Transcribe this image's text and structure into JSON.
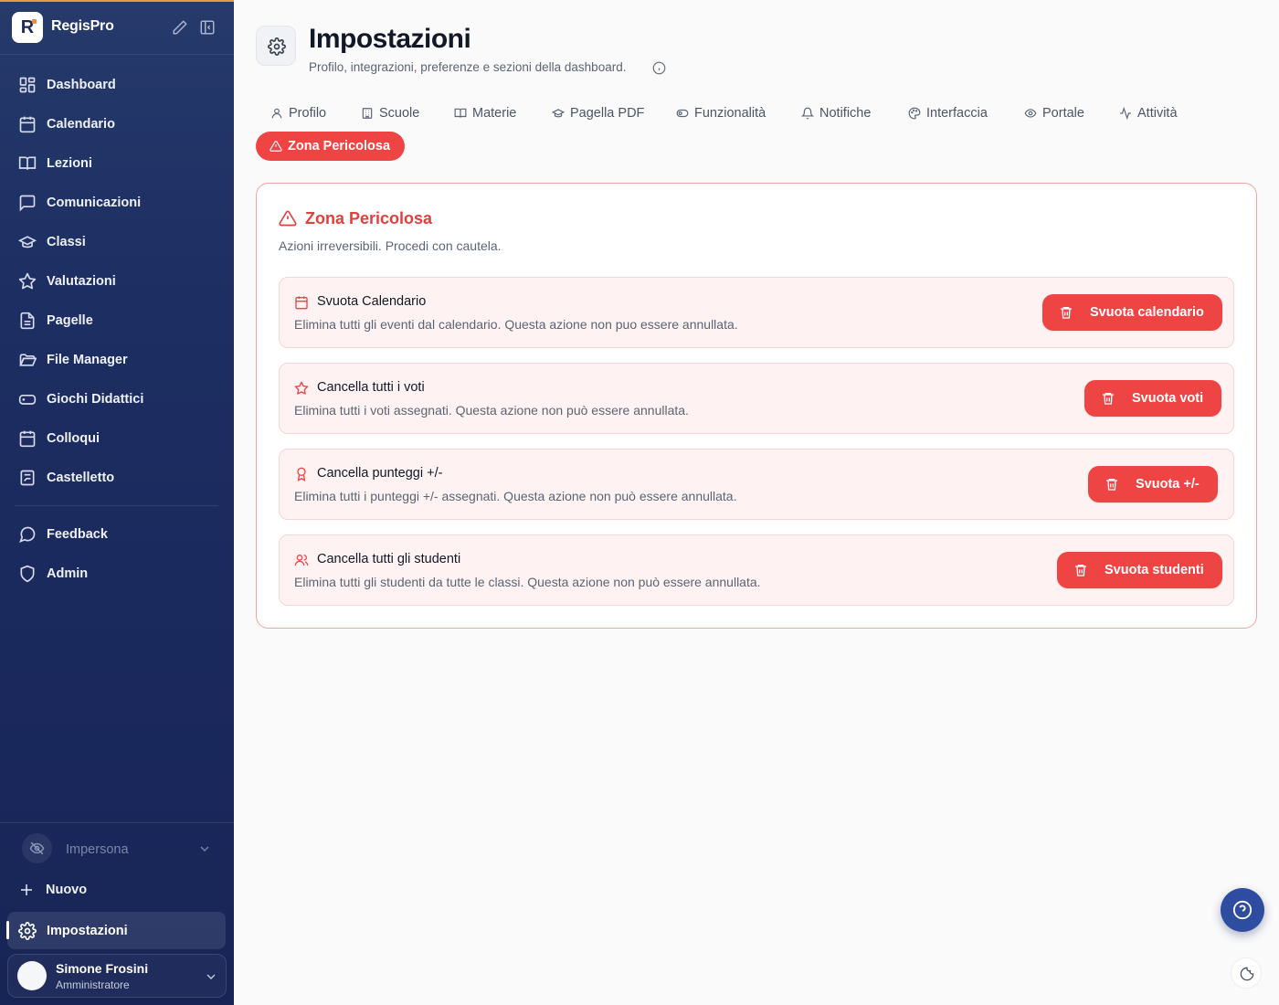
{
  "brand": {
    "name": "RegisPro",
    "logo_letter": "R"
  },
  "sidebar": {
    "items": [
      {
        "label": "Dashboard",
        "icon": "layout-grid-icon"
      },
      {
        "label": "Calendario",
        "icon": "calendar-icon"
      },
      {
        "label": "Lezioni",
        "icon": "book-open-icon"
      },
      {
        "label": "Comunicazioni",
        "icon": "message-square-icon"
      },
      {
        "label": "Classi",
        "icon": "graduation-cap-icon"
      },
      {
        "label": "Valutazioni",
        "icon": "star-icon"
      },
      {
        "label": "Pagelle",
        "icon": "file-text-icon"
      },
      {
        "label": "File Manager",
        "icon": "folder-open-icon"
      },
      {
        "label": "Giochi Didattici",
        "icon": "gamepad-icon"
      },
      {
        "label": "Colloqui",
        "icon": "calendar-days-icon"
      },
      {
        "label": "Castelletto",
        "icon": "clipboard-check-icon"
      }
    ],
    "secondary": [
      {
        "label": "Feedback",
        "icon": "message-circle-icon"
      },
      {
        "label": "Admin",
        "icon": "shield-icon"
      }
    ],
    "impersona_label": "Impersona",
    "nuovo_label": "Nuovo",
    "settings_label": "Impostazioni",
    "user": {
      "name": "Simone Frosini",
      "role": "Amministratore"
    }
  },
  "page": {
    "title": "Impostazioni",
    "subtitle": "Profilo, integrazioni, preferenze e sezioni della dashboard."
  },
  "tabs": [
    {
      "label": "Profilo",
      "icon": "user-icon"
    },
    {
      "label": "Scuole",
      "icon": "building-icon"
    },
    {
      "label": "Materie",
      "icon": "book-open-icon"
    },
    {
      "label": "Pagella PDF",
      "icon": "graduation-cap-icon"
    },
    {
      "label": "Funzionalità",
      "icon": "toggle-icon"
    },
    {
      "label": "Notifiche",
      "icon": "bell-icon"
    },
    {
      "label": "Interfaccia",
      "icon": "palette-icon"
    },
    {
      "label": "Portale",
      "icon": "eye-icon"
    },
    {
      "label": "Attività",
      "icon": "activity-icon"
    }
  ],
  "active_tab": {
    "label": "Zona Pericolosa",
    "icon": "alert-triangle-icon"
  },
  "danger": {
    "title": "Zona Pericolosa",
    "subtitle": "Azioni irreversibili. Procedi con cautela.",
    "actions": [
      {
        "title": "Svuota Calendario",
        "desc": "Elimina tutti gli eventi dal calendario. Questa azione non puo essere annullata.",
        "button": "Svuota calendario",
        "icon": "calendar-icon"
      },
      {
        "title": "Cancella tutti i voti",
        "desc": "Elimina tutti i voti assegnati. Questa azione non può essere annullata.",
        "button": "Svuota voti",
        "icon": "star-icon"
      },
      {
        "title": "Cancella punteggi +/-",
        "desc": "Elimina tutti i punteggi +/- assegnati. Questa azione non può essere annullata.",
        "button": "Svuota +/-",
        "icon": "award-icon"
      },
      {
        "title": "Cancella tutti gli studenti",
        "desc": "Elimina tutti gli studenti da tutte le classi. Questa azione non può essere annullata.",
        "button": "Svuota studenti",
        "icon": "users-icon"
      }
    ]
  },
  "colors": {
    "sidebar": "#1d2e62",
    "accent": "#ef4444",
    "danger_bg": "#fef3f2",
    "help": "#2f4da0"
  }
}
